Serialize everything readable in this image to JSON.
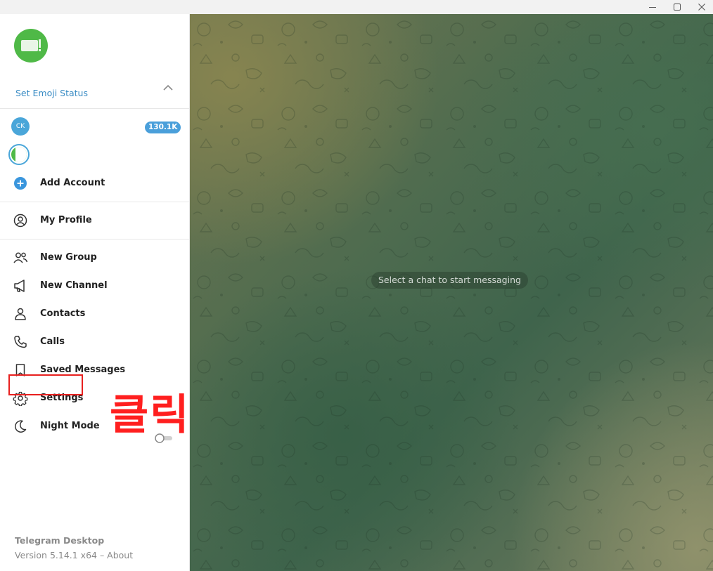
{
  "window": {
    "controls": [
      "minimize",
      "maximize",
      "close"
    ]
  },
  "sidebar": {
    "emoji_status_label": "Set Emoji Status",
    "accounts": [
      {
        "initials": "CK",
        "name": "",
        "unread_badge": "130.1K",
        "color": "#4aa6d9"
      },
      {
        "initials": "",
        "name": "",
        "color": "#4fb947"
      }
    ],
    "add_account_label": "Add Account",
    "my_profile_label": "My Profile",
    "menu": [
      {
        "id": "new-group",
        "label": "New Group",
        "icon": "group-icon"
      },
      {
        "id": "new-channel",
        "label": "New Channel",
        "icon": "megaphone-icon"
      },
      {
        "id": "contacts",
        "label": "Contacts",
        "icon": "person-icon"
      },
      {
        "id": "calls",
        "label": "Calls",
        "icon": "phone-icon"
      },
      {
        "id": "saved-messages",
        "label": "Saved Messages",
        "icon": "bookmark-icon"
      },
      {
        "id": "settings",
        "label": "Settings",
        "icon": "gear-icon"
      },
      {
        "id": "night-mode",
        "label": "Night Mode",
        "icon": "moon-icon",
        "toggle_on": false
      }
    ],
    "footer": {
      "app_name": "Telegram Desktop",
      "version_text": "Version 5.14.1 x64 – About"
    }
  },
  "chat": {
    "placeholder": "Select a chat to start messaging"
  },
  "annotation": {
    "text": "클릭",
    "color": "#e8201f"
  },
  "colors": {
    "accent": "#3a8cc4",
    "badge": "#4a9fda",
    "avatar_green": "#4fb947"
  }
}
